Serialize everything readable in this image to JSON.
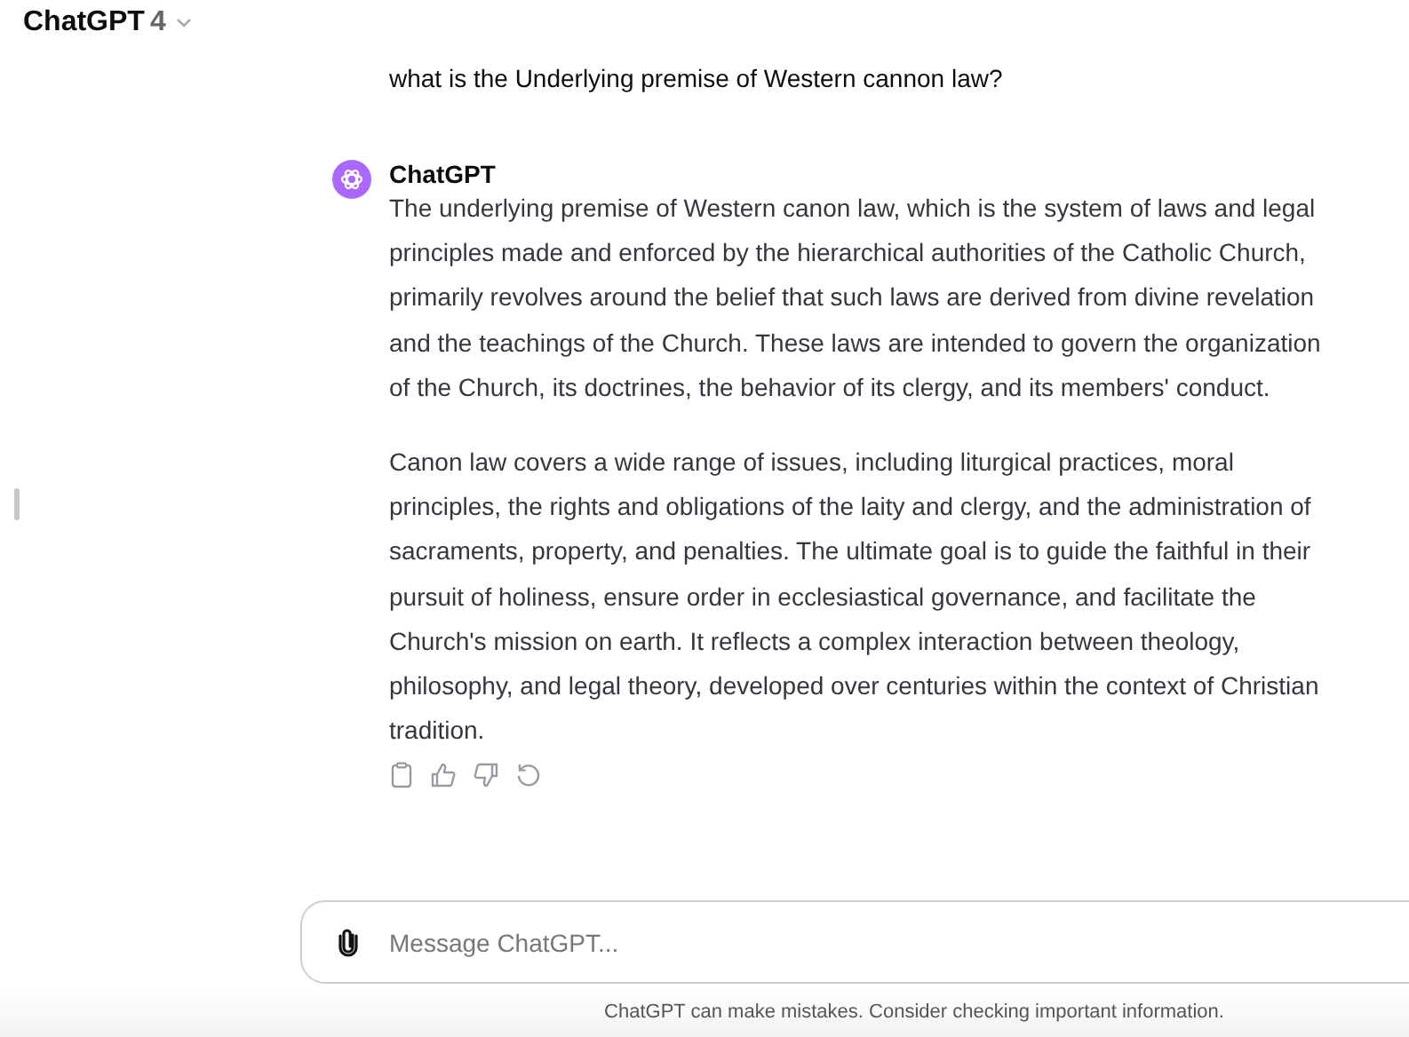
{
  "header": {
    "title": "ChatGPT",
    "version": "4"
  },
  "messages": [
    {
      "kind": "user",
      "text": "what is the Underlying premise of Western cannon law?"
    },
    {
      "kind": "assistant",
      "author": "ChatGPT",
      "paragraphs": [
        "The underlying premise of Western canon law, which is the system of laws and legal principles made and enforced by the hierarchical authorities of the Catholic Church, primarily revolves around the belief that such laws are derived from divine revelation and the teachings of the Church. These laws are intended to govern the organization of the Church, its doctrines, the behavior of its clergy, and its members' conduct.",
        "Canon law covers a wide range of issues, including liturgical practices, moral principles, the rights and obligations of the laity and clergy, and the administration of sacraments, property, and penalties. The ultimate goal is to guide the faithful in their pursuit of holiness, ensure order in ecclesiastical governance, and facilitate the Church's mission on earth. It reflects a complex interaction between theology, philosophy, and legal theory, developed over centuries within the context of Christian tradition."
      ]
    }
  ],
  "composer": {
    "placeholder": "Message ChatGPT..."
  },
  "disclaimer": "ChatGPT can make mistakes. Consider checking important information."
}
